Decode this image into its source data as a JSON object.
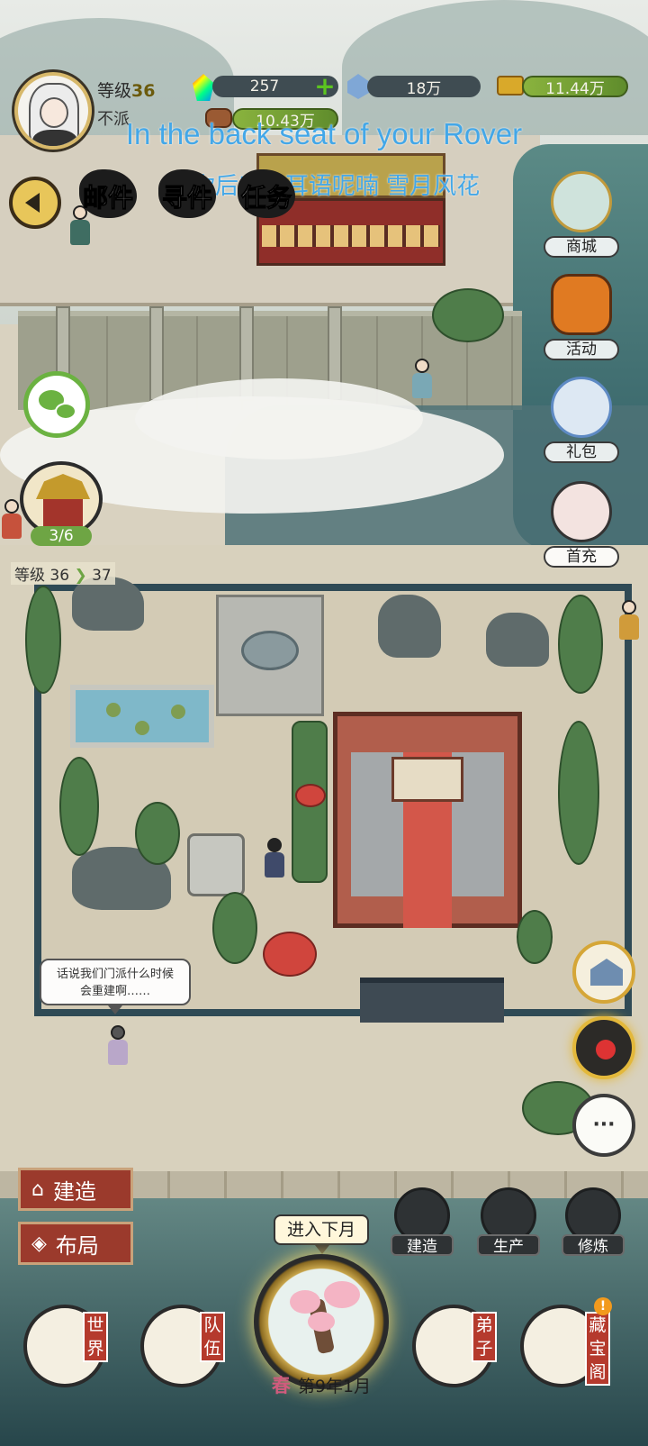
{
  "player": {
    "level_label": "等级",
    "level_value": "36",
    "sect_name": "不派"
  },
  "resources": {
    "gems": {
      "icon": "rainbow-gem-icon",
      "value": "257"
    },
    "crystals": {
      "icon": "blue-crystal-icon",
      "value": "18万"
    },
    "gold": {
      "icon": "gold-ingot-icon",
      "value": "11.44万"
    },
    "wood": {
      "icon": "wood-log-icon",
      "value": "10.43万"
    }
  },
  "overlay": {
    "english": "In the back seat of your Rover",
    "chinese": "在你后座上耳语呢喃 雪月风花"
  },
  "top_buttons": [
    "邮件",
    "寻件",
    "任务"
  ],
  "side_menu": [
    {
      "label": "商城",
      "icon": "pavilion-shop-icon"
    },
    {
      "label": "活动",
      "icon": "lantern-event-icon"
    },
    {
      "label": "礼包",
      "icon": "gift-girl-icon"
    },
    {
      "label": "首充",
      "icon": "first-charge-girl-icon"
    }
  ],
  "sect": {
    "progress": "3/6",
    "level_from": "36",
    "level_to": "37",
    "level_word": "等级"
  },
  "npc_speech": {
    "line1": "话说我们门派什么时候",
    "line2": "会重建啊……"
  },
  "left_actions": {
    "build": "建造",
    "layout": "布局"
  },
  "tools": [
    "建造",
    "生产",
    "修炼"
  ],
  "calendar": {
    "next_month": "进入下月",
    "season": "春",
    "date": "第9年1月"
  },
  "bottom_nav": [
    {
      "label": "世界",
      "chars": [
        "世",
        "界"
      ]
    },
    {
      "label": "队伍",
      "chars": [
        "队",
        "伍"
      ]
    },
    {
      "label": "弟子",
      "chars": [
        "弟",
        "子"
      ]
    },
    {
      "label": "藏宝阁",
      "chars": [
        "藏",
        "宝",
        "阁"
      ]
    }
  ],
  "alert_badge": "!",
  "colors": {
    "accent_gold": "#d7b86a",
    "progress_green": "#6ea544",
    "overlay_blue": "#43a7e8",
    "button_red": "#9b3a2c"
  }
}
